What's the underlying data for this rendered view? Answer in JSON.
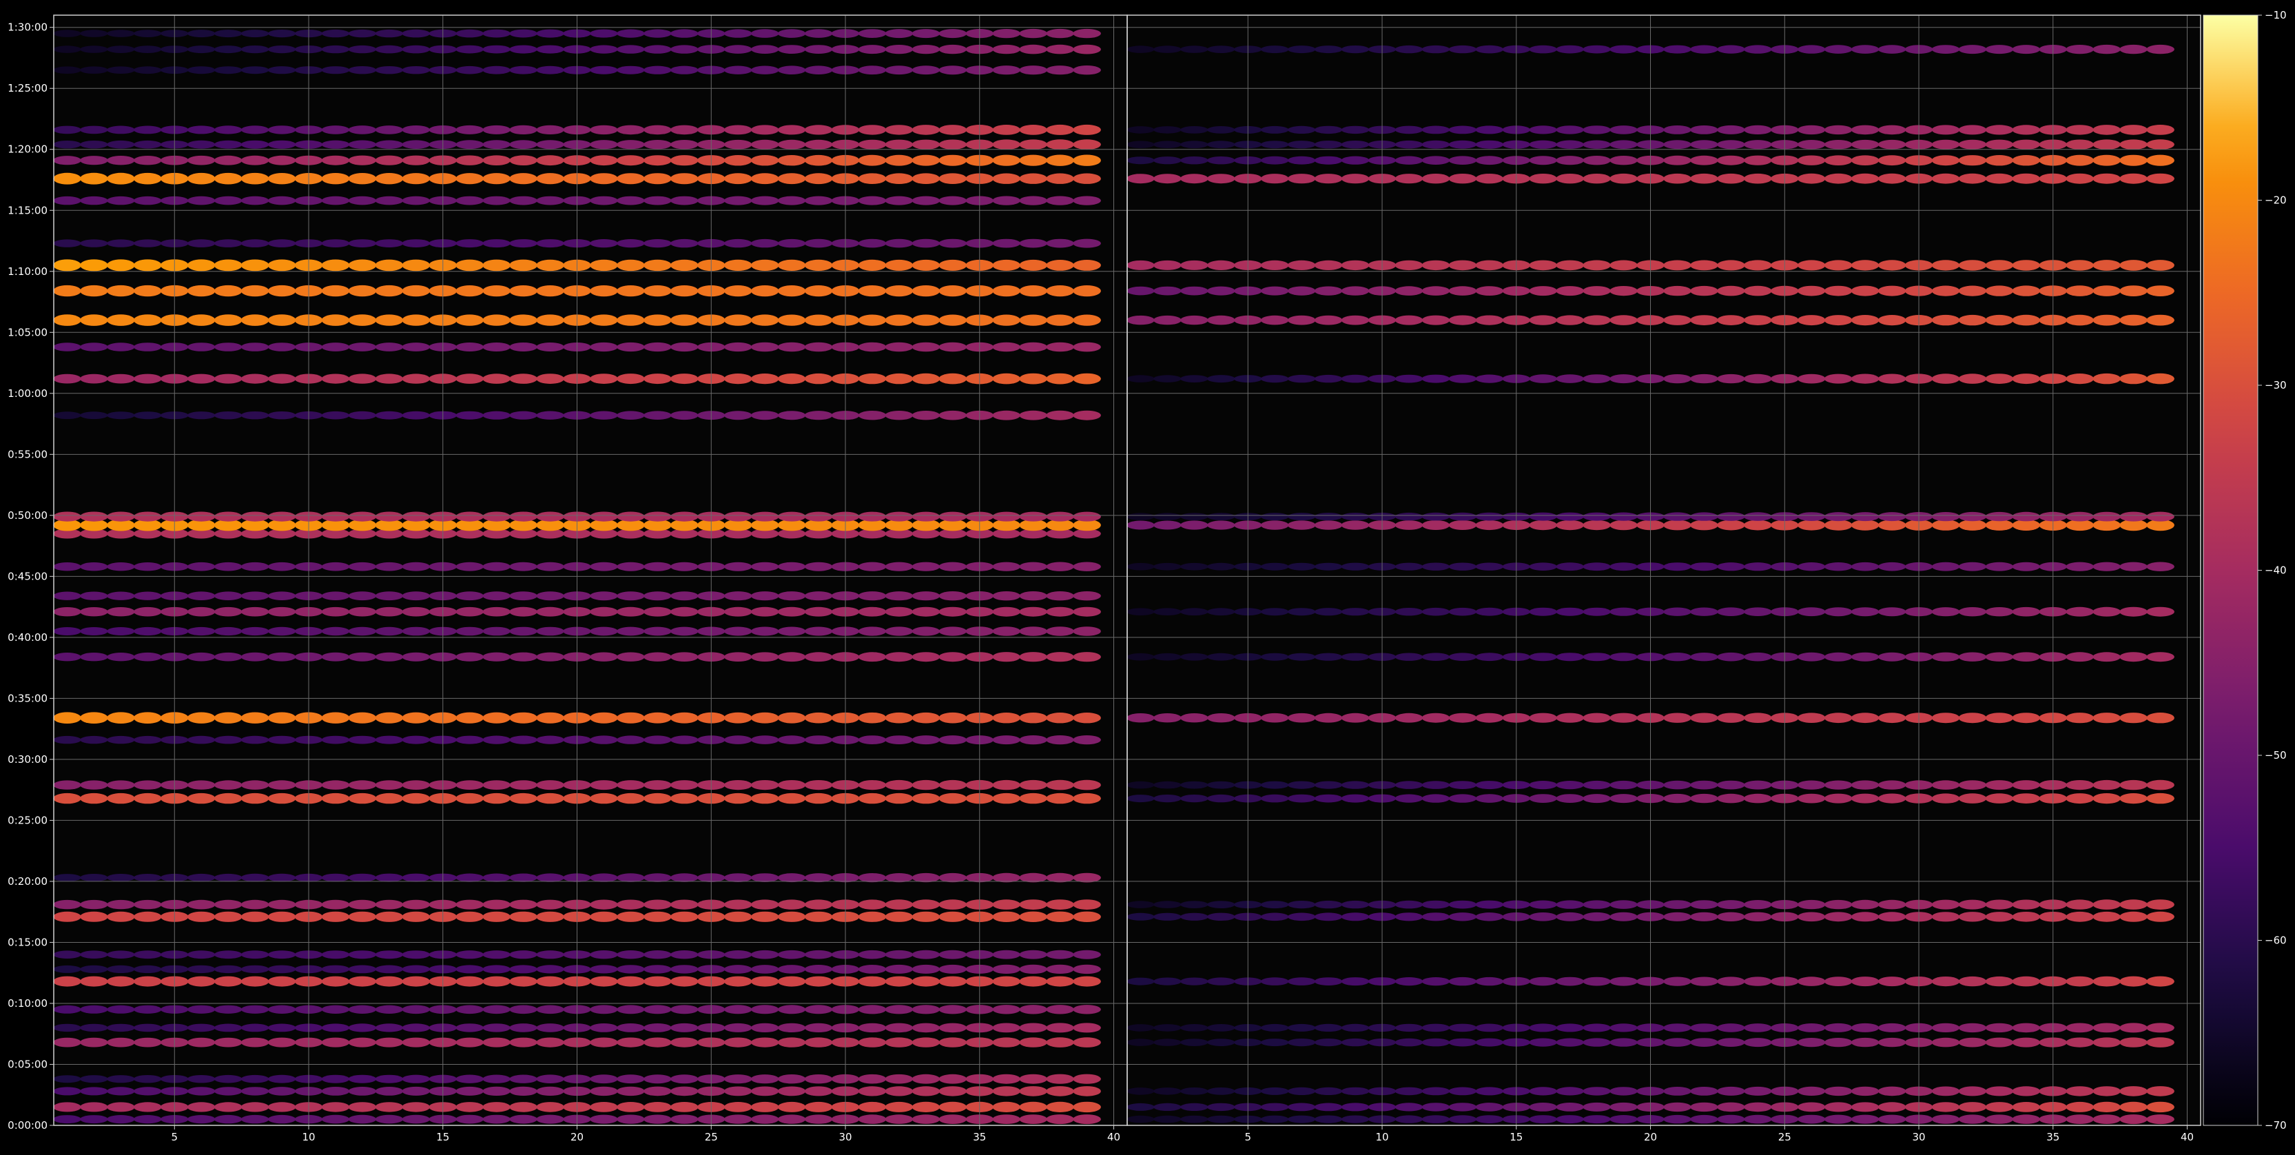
{
  "chart_data": {
    "type": "heatmap",
    "title": "",
    "xlabel": "",
    "ylabel": "",
    "panels": [
      {
        "name": "",
        "xlim": [
          1,
          40
        ],
        "xticks": [
          5,
          10,
          15,
          20,
          25,
          30,
          35,
          40
        ],
        "ylim_minutes": [
          0,
          91
        ],
        "yticks": [
          "0:00:00",
          "0:05:00",
          "0:10:00",
          "0:15:00",
          "0:20:00",
          "0:25:00",
          "0:30:00",
          "0:35:00",
          "0:40:00",
          "0:45:00",
          "0:50:00",
          "0:55:00",
          "1:00:00",
          "1:05:00",
          "1:10:00",
          "1:15:00",
          "1:20:00",
          "1:25:00",
          "1:30:00"
        ],
        "yticks_minutes": [
          0,
          5,
          10,
          15,
          20,
          25,
          30,
          35,
          40,
          45,
          50,
          55,
          60,
          65,
          70,
          75,
          80,
          85,
          90
        ],
        "bands": [
          {
            "t": 0.5,
            "left": -55,
            "right": -40
          },
          {
            "t": 1.5,
            "left": -40,
            "right": -30
          },
          {
            "t": 2.8,
            "left": -55,
            "right": -35
          },
          {
            "t": 3.8,
            "left": -62,
            "right": -38
          },
          {
            "t": 6.8,
            "left": -42,
            "right": -36
          },
          {
            "t": 8.0,
            "left": -60,
            "right": -40
          },
          {
            "t": 9.5,
            "left": -55,
            "right": -44
          },
          {
            "t": 11.8,
            "left": -33,
            "right": -32
          },
          {
            "t": 12.8,
            "left": -62,
            "right": -45
          },
          {
            "t": 14.0,
            "left": -58,
            "right": -48
          },
          {
            "t": 17.1,
            "left": -32,
            "right": -30
          },
          {
            "t": 18.1,
            "left": -45,
            "right": -34
          },
          {
            "t": 20.3,
            "left": -62,
            "right": -42
          },
          {
            "t": 26.8,
            "left": -30,
            "right": -30
          },
          {
            "t": 27.9,
            "left": -45,
            "right": -36
          },
          {
            "t": 31.6,
            "left": -60,
            "right": -46
          },
          {
            "t": 33.4,
            "left": -20,
            "right": -30
          },
          {
            "t": 38.4,
            "left": -52,
            "right": -38
          },
          {
            "t": 40.5,
            "left": -55,
            "right": -44
          },
          {
            "t": 42.1,
            "left": -44,
            "right": -40
          },
          {
            "t": 43.4,
            "left": -52,
            "right": -44
          },
          {
            "t": 45.8,
            "left": -52,
            "right": -45
          },
          {
            "t": 48.5,
            "left": -38,
            "right": -40
          },
          {
            "t": 49.2,
            "left": -18,
            "right": -20
          },
          {
            "t": 49.9,
            "left": -38,
            "right": -40
          },
          {
            "t": 58.2,
            "left": -64,
            "right": -40
          },
          {
            "t": 61.2,
            "left": -42,
            "right": -26
          },
          {
            "t": 63.8,
            "left": -52,
            "right": -42
          },
          {
            "t": 66.0,
            "left": -20,
            "right": -24
          },
          {
            "t": 68.4,
            "left": -22,
            "right": -24
          },
          {
            "t": 70.5,
            "left": -17,
            "right": -26
          },
          {
            "t": 72.3,
            "left": -60,
            "right": -48
          },
          {
            "t": 75.8,
            "left": -52,
            "right": -46
          },
          {
            "t": 77.6,
            "left": -19,
            "right": -30
          },
          {
            "t": 79.1,
            "left": -46,
            "right": -22
          },
          {
            "t": 80.4,
            "left": -60,
            "right": -34
          },
          {
            "t": 81.6,
            "left": -58,
            "right": -32
          },
          {
            "t": 86.5,
            "left": -66,
            "right": -45
          },
          {
            "t": 88.2,
            "left": -66,
            "right": -42
          },
          {
            "t": 89.5,
            "left": -66,
            "right": -44
          }
        ]
      },
      {
        "name": "",
        "xlim": [
          1,
          40
        ],
        "xticks": [
          5,
          10,
          15,
          20,
          25,
          30,
          35,
          40
        ],
        "bands": [
          {
            "t": 0.5,
            "left": -66,
            "right": -40
          },
          {
            "t": 1.5,
            "left": -62,
            "right": -30
          },
          {
            "t": 2.8,
            "left": -66,
            "right": -35
          },
          {
            "t": 6.8,
            "left": -66,
            "right": -36
          },
          {
            "t": 8.0,
            "left": -66,
            "right": -40
          },
          {
            "t": 11.8,
            "left": -62,
            "right": -32
          },
          {
            "t": 17.1,
            "left": -62,
            "right": -32
          },
          {
            "t": 18.1,
            "left": -66,
            "right": -34
          },
          {
            "t": 26.8,
            "left": -62,
            "right": -30
          },
          {
            "t": 27.9,
            "left": -66,
            "right": -36
          },
          {
            "t": 33.4,
            "left": -45,
            "right": -30
          },
          {
            "t": 38.4,
            "left": -66,
            "right": -40
          },
          {
            "t": 42.1,
            "left": -66,
            "right": -40
          },
          {
            "t": 45.8,
            "left": -66,
            "right": -45
          },
          {
            "t": 49.2,
            "left": -48,
            "right": -22
          },
          {
            "t": 49.9,
            "left": -66,
            "right": -40
          },
          {
            "t": 61.2,
            "left": -66,
            "right": -28
          },
          {
            "t": 66.0,
            "left": -45,
            "right": -26
          },
          {
            "t": 68.4,
            "left": -50,
            "right": -26
          },
          {
            "t": 70.5,
            "left": -40,
            "right": -28
          },
          {
            "t": 77.6,
            "left": -40,
            "right": -32
          },
          {
            "t": 79.1,
            "left": -62,
            "right": -24
          },
          {
            "t": 80.4,
            "left": -66,
            "right": -34
          },
          {
            "t": 81.6,
            "left": -66,
            "right": -34
          },
          {
            "t": 88.2,
            "left": -66,
            "right": -44
          }
        ]
      }
    ],
    "colorbar": {
      "colormap": "inferno",
      "range": [
        -70,
        -10
      ],
      "ticks": [
        -10,
        -20,
        -30,
        -40,
        -50,
        -60,
        -70
      ]
    },
    "grid": true
  },
  "colors": {
    "background": "#000000",
    "axes_face": "#050505",
    "grid": "#6a6a6a",
    "text": "#ffffff"
  }
}
